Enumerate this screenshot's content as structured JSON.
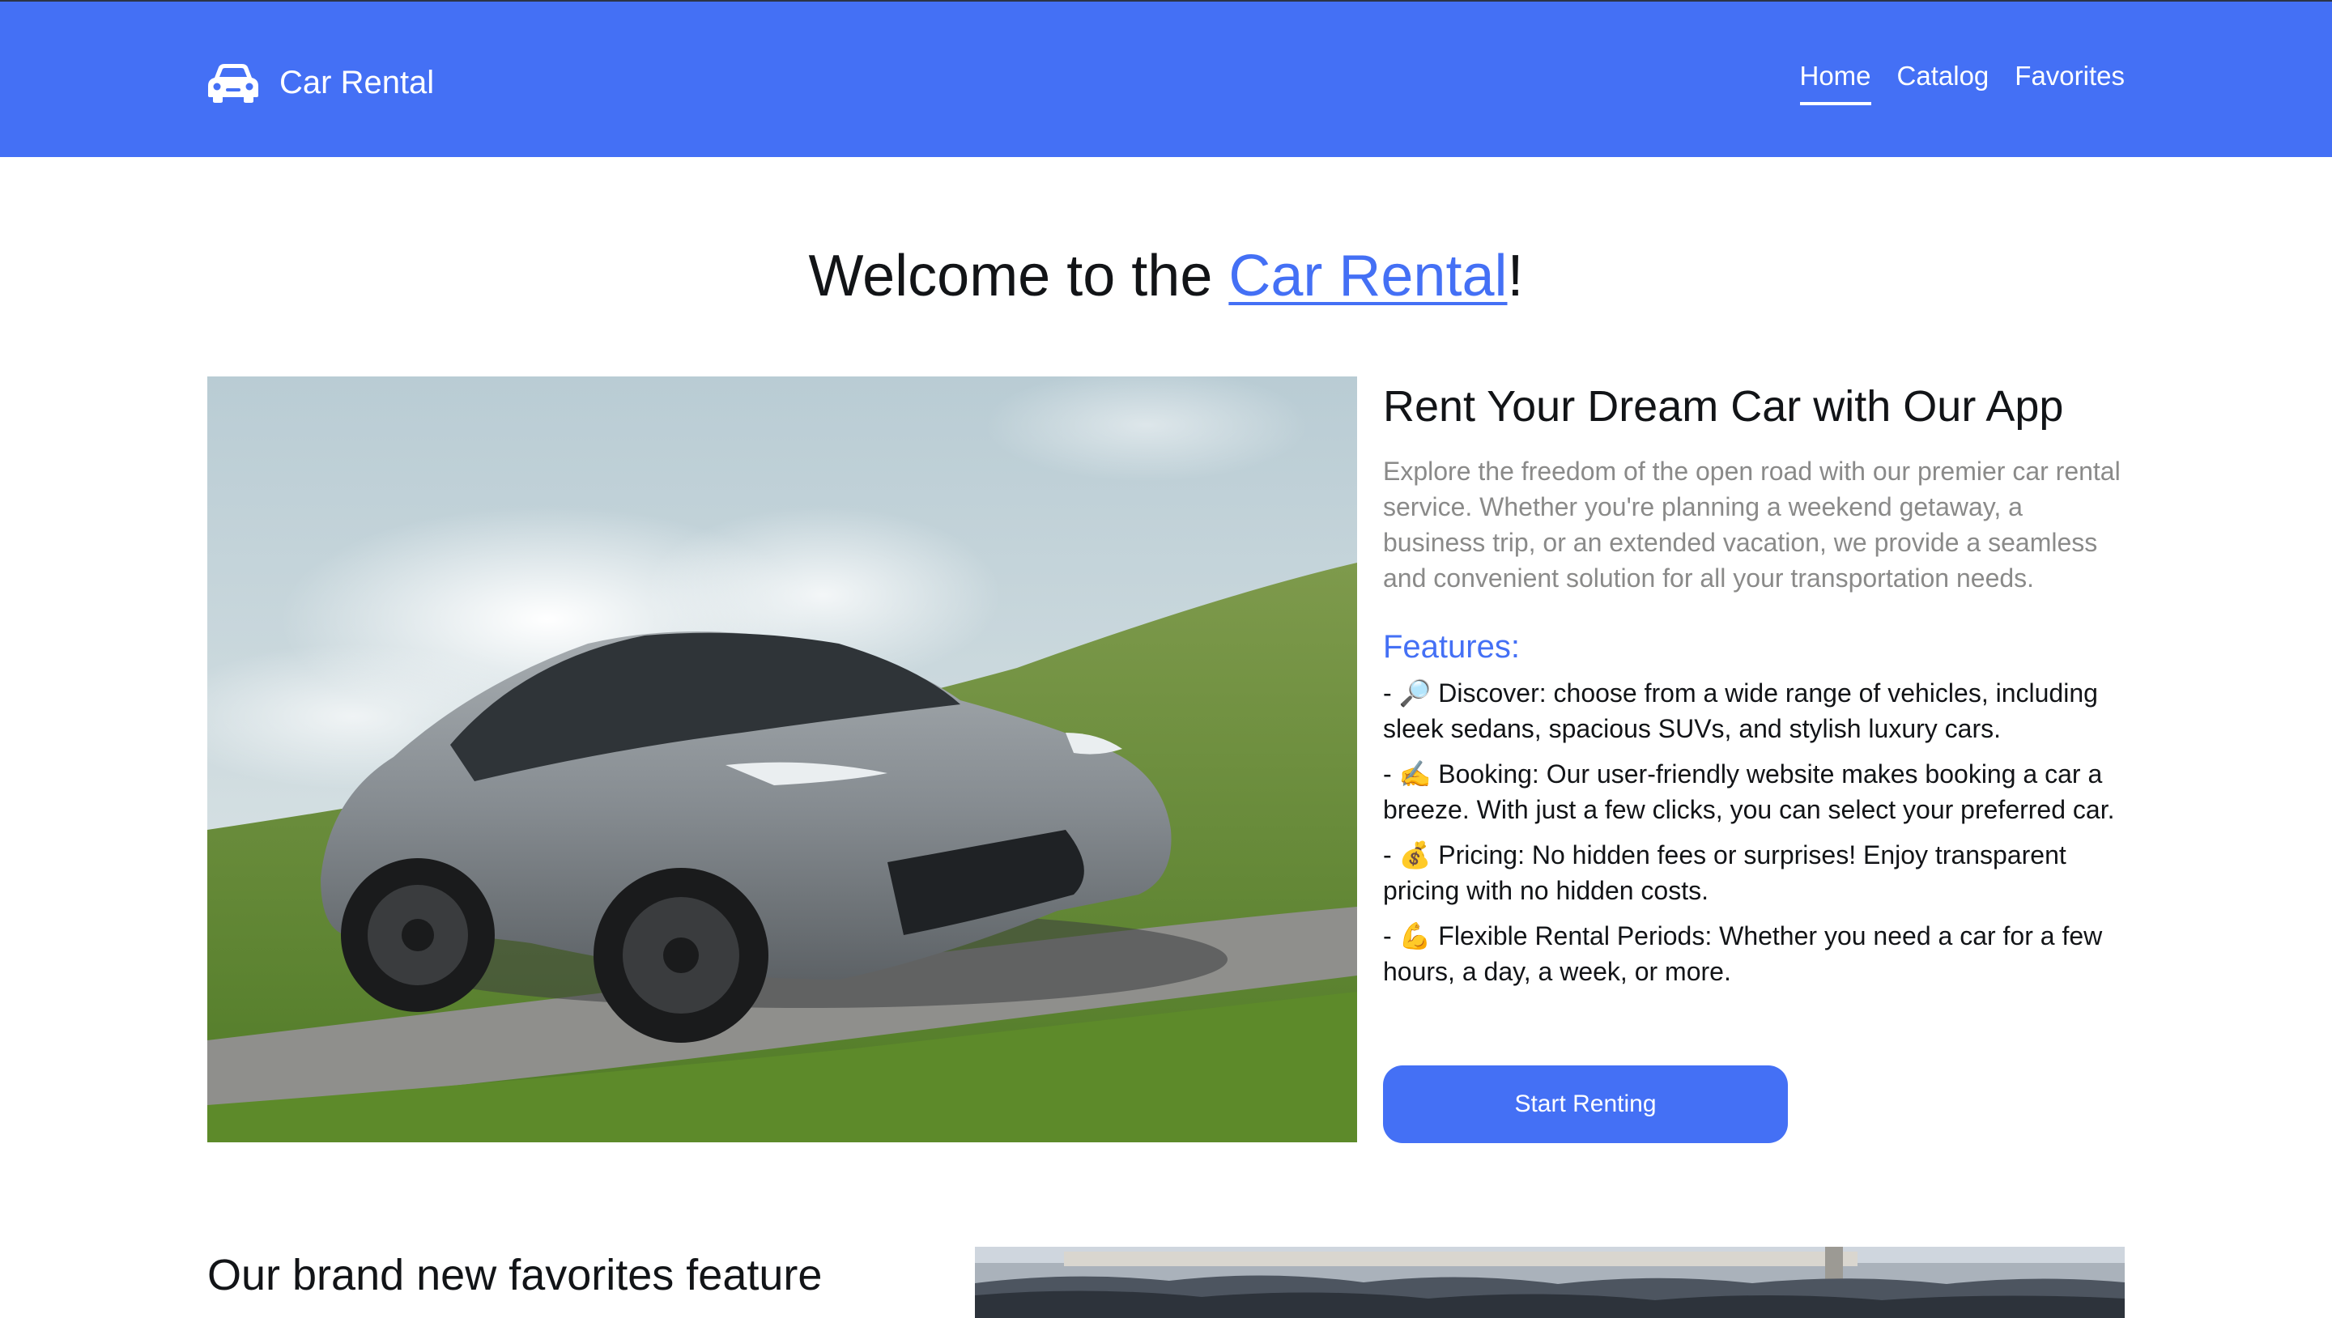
{
  "header": {
    "logo_icon": "car-icon",
    "logo_text": "Car Rental",
    "nav": [
      {
        "label": "Home",
        "active": true
      },
      {
        "label": "Catalog",
        "active": false
      },
      {
        "label": "Favorites",
        "active": false
      }
    ],
    "colors": {
      "accent": "#4470f5"
    }
  },
  "welcome": {
    "prefix": "Welcome to the ",
    "highlight": "Car Rental",
    "suffix": "!"
  },
  "hero": {
    "image": "grey-sports-car-on-track-photo",
    "title": "Rent Your Dream Car with Our App",
    "description": "Explore the freedom of the open road with our premier car rental service. Whether you're planning a weekend getaway, a business trip, or an extended vacation, we provide a seamless and convenient solution for all your transportation needs.",
    "features_title": "Features:",
    "features": [
      "- 🔎 Discover: choose from a wide range of vehicles, including sleek sedans, spacious SUVs, and stylish luxury cars.",
      "- ✍️ Booking: Our user-friendly website makes booking a car a breeze. With just a few clicks, you can select your preferred car.",
      "- 💰 Pricing: No hidden fees or surprises! Enjoy transparent pricing with no hidden costs.",
      "- 💪 Flexible Rental Periods: Whether you need a car for a few hours, a day, a week, or more."
    ],
    "cta_label": "Start Renting"
  },
  "favorites_section": {
    "title": "Our brand new favorites feature",
    "image": "parked-cars-lot-photo"
  }
}
